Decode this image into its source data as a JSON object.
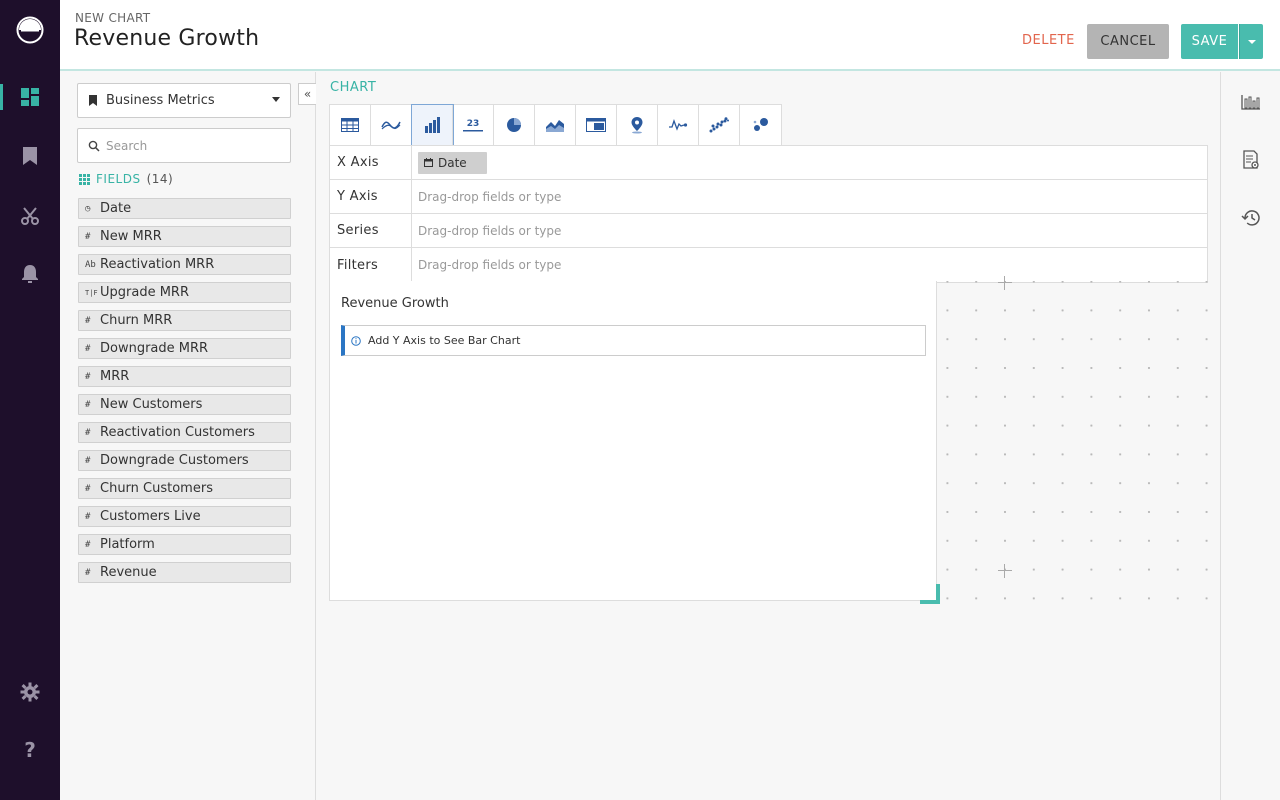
{
  "header": {
    "subtitle": "NEW CHART",
    "title": "Revenue Growth",
    "delete_label": "DELETE",
    "cancel_label": "CANCEL",
    "save_label": "SAVE"
  },
  "rail": {
    "icons": [
      "logo-icon",
      "dashboard-icon",
      "bookmark-icon",
      "scissors-icon",
      "bell-icon",
      "gear-icon",
      "help-icon"
    ],
    "active": "dashboard-icon"
  },
  "field_panel": {
    "dataset": "Business Metrics",
    "search_placeholder": "Search",
    "fields_label": "FIELDS",
    "fields_count": "(14)",
    "fields": [
      {
        "type_glyph": "◷",
        "type": "date",
        "name": "Date"
      },
      {
        "type_glyph": "#",
        "type": "number",
        "name": "New MRR"
      },
      {
        "type_glyph": "Ab",
        "type": "string",
        "name": "Reactivation MRR"
      },
      {
        "type_glyph": "T|F",
        "type": "boolean",
        "name": "Upgrade MRR"
      },
      {
        "type_glyph": "#",
        "type": "number",
        "name": "Churn MRR"
      },
      {
        "type_glyph": "#",
        "type": "number",
        "name": "Downgrade MRR"
      },
      {
        "type_glyph": "#",
        "type": "number",
        "name": "MRR"
      },
      {
        "type_glyph": "#",
        "type": "number",
        "name": "New Customers"
      },
      {
        "type_glyph": "#",
        "type": "number",
        "name": "Reactivation Customers"
      },
      {
        "type_glyph": "#",
        "type": "number",
        "name": "Downgrade Customers"
      },
      {
        "type_glyph": "#",
        "type": "number",
        "name": "Churn Customers"
      },
      {
        "type_glyph": "#",
        "type": "number",
        "name": "Customers Live"
      },
      {
        "type_glyph": "#",
        "type": "number",
        "name": "Platform"
      },
      {
        "type_glyph": "#",
        "type": "number",
        "name": "Revenue"
      }
    ]
  },
  "chart": {
    "section_label": "CHART",
    "types": [
      "table",
      "line",
      "bar",
      "number",
      "pie",
      "area",
      "pivot",
      "map",
      "sparkline",
      "scatter",
      "bubble"
    ],
    "selected_type": "bar",
    "axes": [
      {
        "name": "X Axis",
        "value": "Date",
        "placeholder": ""
      },
      {
        "name": "Y Axis",
        "value": "",
        "placeholder": "Drag-drop fields or type"
      },
      {
        "name": "Series",
        "value": "",
        "placeholder": "Drag-drop fields or type"
      },
      {
        "name": "Filters",
        "value": "",
        "placeholder": "Drag-drop fields or type"
      }
    ],
    "preview_title": "Revenue Growth",
    "notice": "Add Y Axis to See Bar Chart"
  },
  "right_panel": {
    "icons": [
      "chart-settings-icon",
      "report-settings-icon",
      "history-icon"
    ]
  },
  "colors": {
    "rail_bg": "#1e0f2b",
    "accent": "#49bcae",
    "delete": "#e2654d",
    "chart_icon": "#2b5a9e"
  }
}
